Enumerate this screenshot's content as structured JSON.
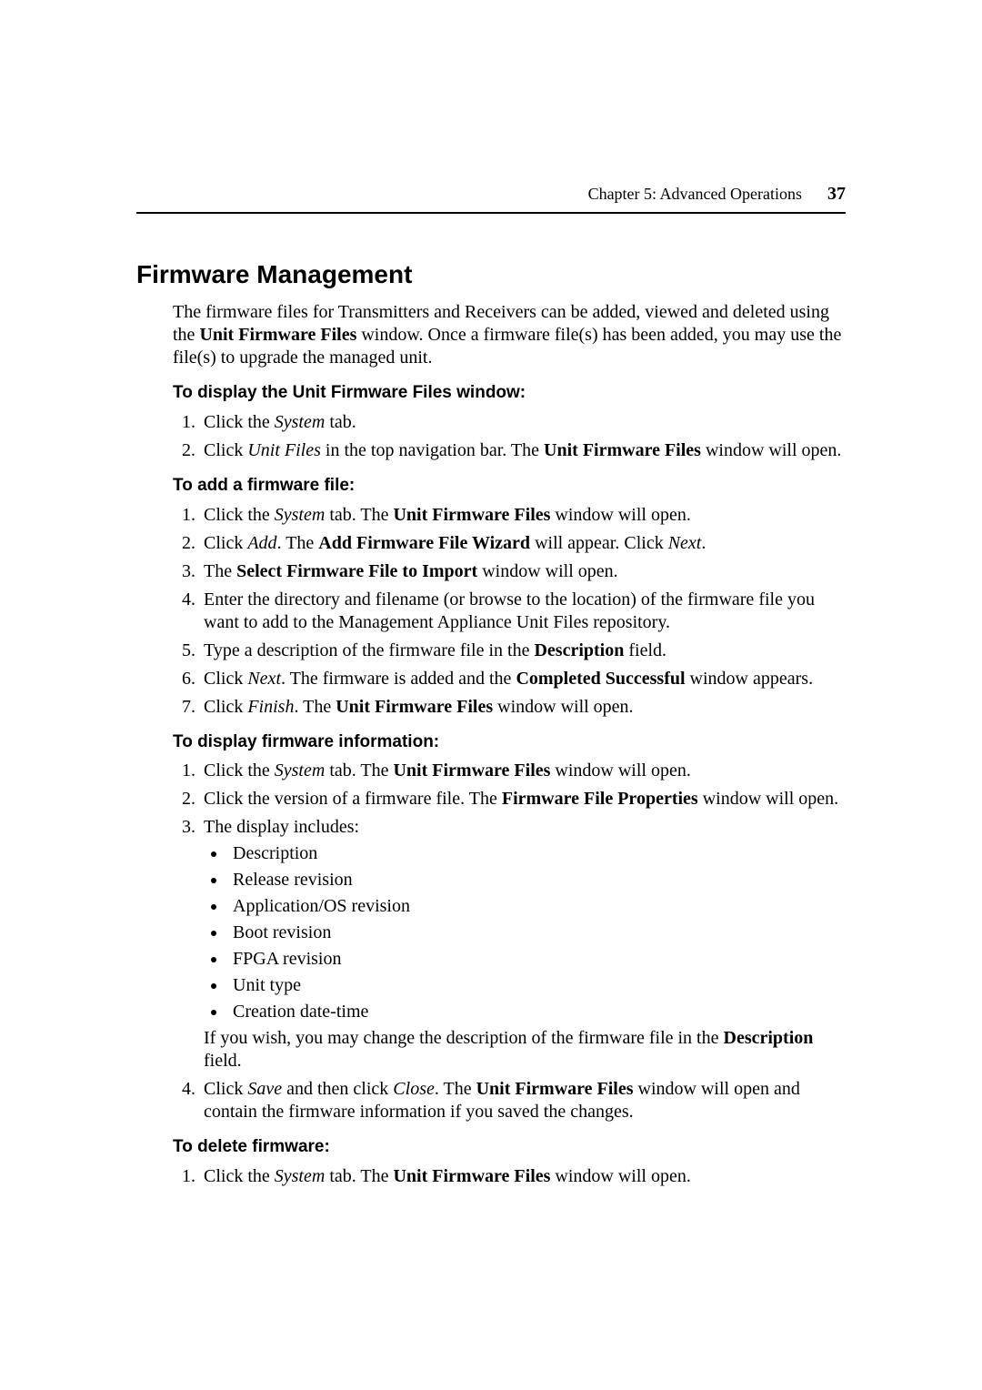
{
  "header": {
    "chapter": "Chapter 5: Advanced Operations",
    "page_number": "37"
  },
  "h1": "Firmware Management",
  "intro": {
    "t1": "The firmware files for Transmitters and Receivers can be added, viewed and deleted using the ",
    "b1": "Unit Firmware Files",
    "t2": " window. Once a firmware file(s) has been added, you may use the file(s) to upgrade the managed unit."
  },
  "sec1": {
    "head": "To display the Unit Firmware Files window:",
    "li1_a": "Click the ",
    "li1_i": "System",
    "li1_b": " tab.",
    "li2_a": "Click ",
    "li2_i": "Unit Files",
    "li2_b": " in the top navigation bar. The ",
    "li2_bold": "Unit Firmware Files",
    "li2_c": " window will open."
  },
  "sec2": {
    "head": "To add a firmware file:",
    "li1_a": "Click the ",
    "li1_i": "System",
    "li1_b": " tab. The ",
    "li1_bold": "Unit Firmware Files",
    "li1_c": " window will open.",
    "li2_a": "Click ",
    "li2_i1": "Add",
    "li2_b": ". The ",
    "li2_bold": "Add Firmware File Wizard",
    "li2_c": " will appear. Click ",
    "li2_i2": "Next",
    "li2_d": ".",
    "li3_a": "The ",
    "li3_bold": "Select Firmware File to Import",
    "li3_b": " window will open.",
    "li4": "Enter the directory and filename (or browse to the location) of the firmware file you want to add to the Management Appliance Unit Files repository.",
    "li5_a": "Type a description of the firmware file in the ",
    "li5_bold": "Description",
    "li5_b": " field.",
    "li6_a": "Click ",
    "li6_i": "Next",
    "li6_b": ". The firmware is added and the ",
    "li6_bold": "Completed Successful",
    "li6_c": " window appears.",
    "li7_a": "Click ",
    "li7_i": "Finish",
    "li7_b": ". The ",
    "li7_bold": "Unit Firmware Files",
    "li7_c": " window will open."
  },
  "sec3": {
    "head": "To display firmware information:",
    "li1_a": "Click the ",
    "li1_i": "System",
    "li1_b": " tab. The ",
    "li1_bold": "Unit Firmware Files",
    "li1_c": " window will open.",
    "li2_a": "Click the version of a firmware file. The ",
    "li2_bold": "Firmware File Properties",
    "li2_b": " window will open.",
    "li3_a": "The display includes:",
    "bullets": {
      "b1": "Description",
      "b2": "Release revision",
      "b3": "Application/OS revision",
      "b4": "Boot revision",
      "b5": "FPGA revision",
      "b6": "Unit type",
      "b7": "Creation date-time"
    },
    "after_a": "If you wish, you may change the description of the firmware file in the ",
    "after_bold": "Description",
    "after_b": " field.",
    "li4_a": "Click ",
    "li4_i1": "Save",
    "li4_b": " and then click ",
    "li4_i2": "Close",
    "li4_c": ". The ",
    "li4_bold": "Unit Firmware Files",
    "li4_d": " window will open and contain the firmware information if you saved the changes."
  },
  "sec4": {
    "head": "To delete firmware:",
    "li1_a": "Click the ",
    "li1_i": "System",
    "li1_b": " tab. The ",
    "li1_bold": "Unit Firmware Files",
    "li1_c": " window will open."
  }
}
